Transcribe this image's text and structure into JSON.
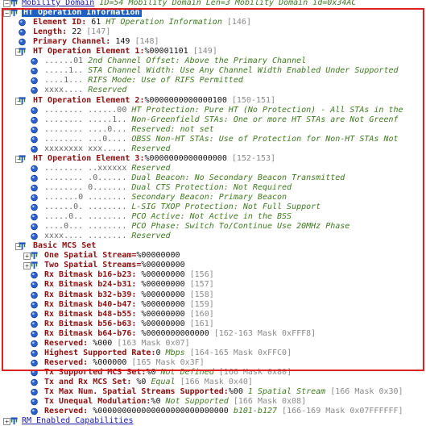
{
  "rows": [
    {
      "id": "mobility",
      "indent": 0,
      "exp": "minus",
      "icon": "tree",
      "label": "Mobility Domain",
      "style": "lbl-blue",
      "rest": " ID=54 Mobility Domain Len=3 Mobility Domain id=0x34AC",
      "rest_style": "desc"
    },
    {
      "id": "ht-op-info",
      "indent": 0,
      "exp": "minus",
      "icon": "tree",
      "label": "HT Operation Information",
      "style": "lbl-sel"
    },
    {
      "id": "element-id",
      "indent": 1,
      "icon": "dot",
      "label": "Element ID:",
      "value": "61",
      "desc": "HT Operation Information",
      "ref": "[146]"
    },
    {
      "id": "length",
      "indent": 1,
      "icon": "dot",
      "label": "Length:",
      "value": "22",
      "ref": "[147]"
    },
    {
      "id": "primary-channel",
      "indent": 1,
      "icon": "dot",
      "label": "Primary Channel:",
      "value": "149",
      "ref": "[148]"
    },
    {
      "id": "ht-op-el-1",
      "indent": 1,
      "exp": "minus",
      "icon": "tree",
      "label": "HT Operation Element 1:",
      "value": "%00001101",
      "ref": "[149]"
    },
    {
      "id": "e1-b1",
      "indent": 2,
      "icon": "dot",
      "bits": "......01",
      "desc": "2nd Channel Offset: Above the Primary Channel"
    },
    {
      "id": "e1-b2",
      "indent": 2,
      "icon": "dot",
      "bits": ".....1..",
      "desc": "STA Channel Width: Use Any Channel Width Enabled Under Supported"
    },
    {
      "id": "e1-b3",
      "indent": 2,
      "icon": "dot",
      "bits": "....1...",
      "desc": "RIFS Mode: Use of RIFS Permitted"
    },
    {
      "id": "e1-b4",
      "indent": 2,
      "icon": "dot",
      "bits": "xxxx....",
      "desc": "Reserved"
    },
    {
      "id": "ht-op-el-2",
      "indent": 1,
      "exp": "minus",
      "icon": "tree",
      "label": "HT Operation Element 2:",
      "value": "%0000000000000100",
      "ref": "[150-151]"
    },
    {
      "id": "e2-b1",
      "indent": 2,
      "icon": "dot",
      "bits": "........ ......00",
      "desc": "HT Protection: Pure HT (No Protection) - All STAs in the"
    },
    {
      "id": "e2-b2",
      "indent": 2,
      "icon": "dot",
      "bits": "........ .....1..",
      "desc": "Non-Greenfield STAs: One or more HT STAs are Not Greenf"
    },
    {
      "id": "e2-b3",
      "indent": 2,
      "icon": "dot",
      "bits": "........ ....0...",
      "desc": "Reserved: not set"
    },
    {
      "id": "e2-b4",
      "indent": 2,
      "icon": "dot",
      "bits": "........ ...0....",
      "desc": "OBSS Non-HT STAs: Use of Protection for Non-HT STAs Not"
    },
    {
      "id": "e2-b5",
      "indent": 2,
      "icon": "dot",
      "bits": "xxxxxxxx xxx.....",
      "desc": "Reserved"
    },
    {
      "id": "ht-op-el-3",
      "indent": 1,
      "exp": "minus",
      "icon": "tree",
      "label": "HT Operation Element 3:",
      "value": "%0000000000000000",
      "ref": "[152-153]"
    },
    {
      "id": "e3-b1",
      "indent": 2,
      "icon": "dot",
      "bits": "........ ..xxxxxx",
      "desc": "Reserved"
    },
    {
      "id": "e3-b2",
      "indent": 2,
      "icon": "dot",
      "bits": "........ .0......",
      "desc": "Dual Beacon: No Secondary Beacon Transmitted"
    },
    {
      "id": "e3-b3",
      "indent": 2,
      "icon": "dot",
      "bits": "........ 0.......",
      "desc": "Dual CTS Protection: Not Required"
    },
    {
      "id": "e3-b4",
      "indent": 2,
      "icon": "dot",
      "bits": ".......0 ........",
      "desc": "Secondary Beacon: Primary Beacon"
    },
    {
      "id": "e3-b5",
      "indent": 2,
      "icon": "dot",
      "bits": "......0. ........",
      "desc": "L-SIG TXOP Protection: Not Full Support"
    },
    {
      "id": "e3-b6",
      "indent": 2,
      "icon": "dot",
      "bits": ".....0.. ........",
      "desc": "PCO Active: Not Active in the BSS"
    },
    {
      "id": "e3-b7",
      "indent": 2,
      "icon": "dot",
      "bits": "....0... ........",
      "desc": "PCO Phase: Switch To/Continue Use 20MHz Phase"
    },
    {
      "id": "e3-b8",
      "indent": 2,
      "icon": "dot",
      "bits": "xxxx.... ........",
      "desc": "Reserved"
    },
    {
      "id": "basic-mcs",
      "indent": 1,
      "exp": "minus",
      "icon": "tree",
      "label": "Basic MCS Set"
    },
    {
      "id": "one-ss",
      "indent": 2,
      "exp": "plus",
      "icon": "tree",
      "label": "One Spatial Stream=",
      "value_inline": "%00000000"
    },
    {
      "id": "two-ss",
      "indent": 2,
      "exp": "plus",
      "icon": "tree",
      "label": "Two Spatial Streams=",
      "value_inline": "%00000000"
    },
    {
      "id": "rx-b16",
      "indent": 2,
      "icon": "dot",
      "label": "Rx Bitmask b16-b23:",
      "value": "%00000000",
      "ref": "[156]"
    },
    {
      "id": "rx-b24",
      "indent": 2,
      "icon": "dot",
      "label": "Rx Bitmask b24-b31:",
      "value": "%00000000",
      "ref": "[157]"
    },
    {
      "id": "rx-b32",
      "indent": 2,
      "icon": "dot",
      "label": "Rx Bitmask b32-b39:",
      "value": "%00000000",
      "ref": "[158]"
    },
    {
      "id": "rx-b40",
      "indent": 2,
      "icon": "dot",
      "label": "Rx Bitmask b40-b47:",
      "value": "%00000000",
      "ref": "[159]"
    },
    {
      "id": "rx-b48",
      "indent": 2,
      "icon": "dot",
      "label": "Rx Bitmask b48-b55:",
      "value": "%00000000",
      "ref": "[160]"
    },
    {
      "id": "rx-b56",
      "indent": 2,
      "icon": "dot",
      "label": "Rx Bitmask b56-b63:",
      "value": "%00000000",
      "ref": "[161]"
    },
    {
      "id": "rx-b64",
      "indent": 2,
      "icon": "dot",
      "label": "Rx Bitmask b64-b76:",
      "value": "%0000000000000",
      "ref": "[162-163 Mask 0xFFF8]"
    },
    {
      "id": "reserved-1",
      "indent": 2,
      "icon": "dot",
      "label": "Reserved:",
      "value": "%000",
      "ref": "[163 Mask 0x07]",
      "valpad": true
    },
    {
      "id": "highest-rate",
      "indent": 2,
      "icon": "dot",
      "label": "Highest Supported Rate:",
      "value": "0",
      "desc": "Mbps",
      "ref": "[164-165 Mask 0xFFC0]",
      "tight": true
    },
    {
      "id": "reserved-2",
      "indent": 2,
      "icon": "dot",
      "label": "Reserved:",
      "value": "%000000",
      "ref": "[165 Mask 0x3F]",
      "valpad": true
    },
    {
      "id": "tx-mcs",
      "indent": 2,
      "icon": "dot",
      "label": "Tx Supported MCS Set:",
      "value": "%0",
      "desc": "Not Defined",
      "ref": "[166 Mask 0x80]",
      "tight": true
    },
    {
      "id": "tx-rx-mcs",
      "indent": 2,
      "icon": "dot",
      "label": "Tx and Rx MCS Set:",
      "value": "%0",
      "desc": "Equal",
      "ref": "[166 Mask 0x40]",
      "valpad2": true
    },
    {
      "id": "tx-max-ss",
      "indent": 2,
      "icon": "dot",
      "label": "Tx Max Num. Spatial Streams Supported:",
      "value": "%00",
      "desc": "1 Spatial Stream",
      "ref": "[166 Mask 0x30]",
      "tight": true
    },
    {
      "id": "tx-unequal",
      "indent": 2,
      "icon": "dot",
      "label": "Tx Unequal Modulation:",
      "value": "%0",
      "desc": "Not Supported",
      "ref": "[166 Mask 0x08]",
      "tight": true
    },
    {
      "id": "reserved-3",
      "indent": 2,
      "icon": "dot",
      "label": "Reserved:",
      "value": "%000000000000000000000000000",
      "desc": "b101-b127",
      "ref": "[166-169 Mask 0x07FFFFFF]",
      "valpad": true
    },
    {
      "id": "rm-enabled",
      "indent": 0,
      "exp": "plus",
      "icon": "tree",
      "label": "RM Enabled Capabilities",
      "style": "lbl-blue"
    }
  ],
  "colors": {
    "label": "#8b1010",
    "link": "#1a1aa8",
    "desc": "#3d7a1f",
    "ref": "#8a8a8a",
    "selection": "#1f5fbf",
    "focus_border": "#dd2222"
  },
  "icons": {
    "tree": "tree-node-icon",
    "dot": "field-dot-icon",
    "minus": "collapse-icon",
    "plus": "expand-icon"
  }
}
